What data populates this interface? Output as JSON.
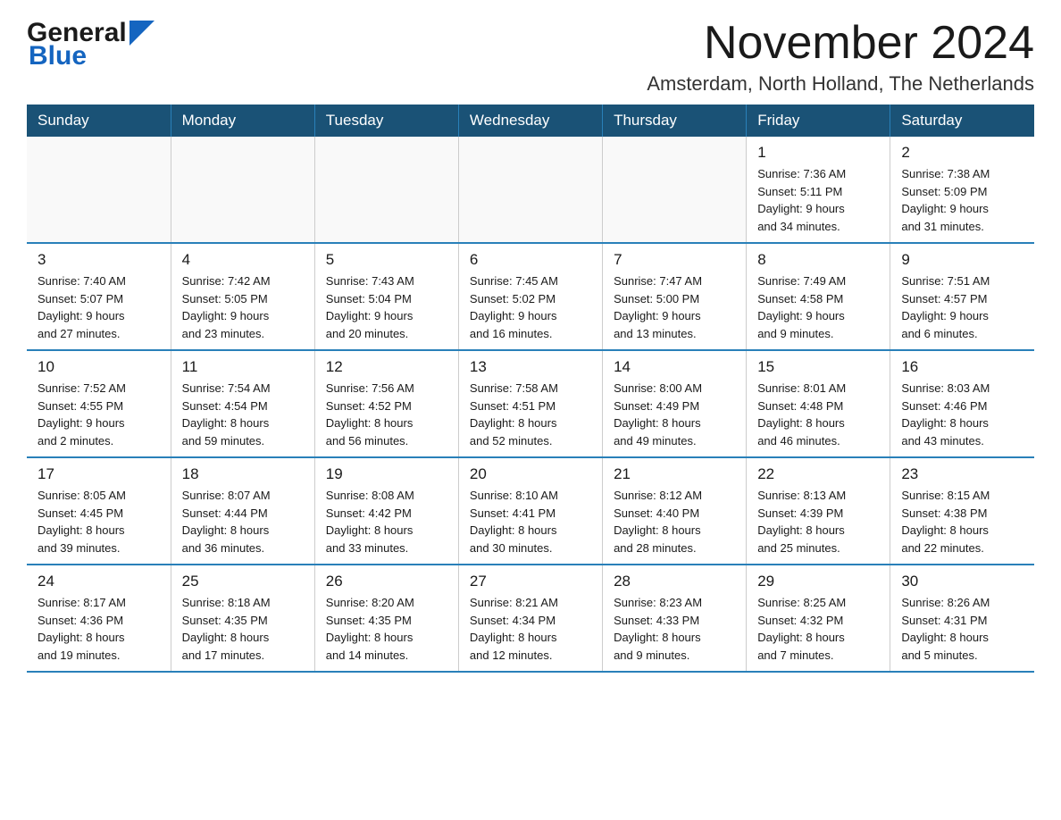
{
  "header": {
    "logo_general": "General",
    "logo_blue": "Blue",
    "month_title": "November 2024",
    "location": "Amsterdam, North Holland, The Netherlands"
  },
  "calendar": {
    "weekdays": [
      "Sunday",
      "Monday",
      "Tuesday",
      "Wednesday",
      "Thursday",
      "Friday",
      "Saturday"
    ],
    "weeks": [
      [
        {
          "day": "",
          "info": ""
        },
        {
          "day": "",
          "info": ""
        },
        {
          "day": "",
          "info": ""
        },
        {
          "day": "",
          "info": ""
        },
        {
          "day": "",
          "info": ""
        },
        {
          "day": "1",
          "info": "Sunrise: 7:36 AM\nSunset: 5:11 PM\nDaylight: 9 hours\nand 34 minutes."
        },
        {
          "day": "2",
          "info": "Sunrise: 7:38 AM\nSunset: 5:09 PM\nDaylight: 9 hours\nand 31 minutes."
        }
      ],
      [
        {
          "day": "3",
          "info": "Sunrise: 7:40 AM\nSunset: 5:07 PM\nDaylight: 9 hours\nand 27 minutes."
        },
        {
          "day": "4",
          "info": "Sunrise: 7:42 AM\nSunset: 5:05 PM\nDaylight: 9 hours\nand 23 minutes."
        },
        {
          "day": "5",
          "info": "Sunrise: 7:43 AM\nSunset: 5:04 PM\nDaylight: 9 hours\nand 20 minutes."
        },
        {
          "day": "6",
          "info": "Sunrise: 7:45 AM\nSunset: 5:02 PM\nDaylight: 9 hours\nand 16 minutes."
        },
        {
          "day": "7",
          "info": "Sunrise: 7:47 AM\nSunset: 5:00 PM\nDaylight: 9 hours\nand 13 minutes."
        },
        {
          "day": "8",
          "info": "Sunrise: 7:49 AM\nSunset: 4:58 PM\nDaylight: 9 hours\nand 9 minutes."
        },
        {
          "day": "9",
          "info": "Sunrise: 7:51 AM\nSunset: 4:57 PM\nDaylight: 9 hours\nand 6 minutes."
        }
      ],
      [
        {
          "day": "10",
          "info": "Sunrise: 7:52 AM\nSunset: 4:55 PM\nDaylight: 9 hours\nand 2 minutes."
        },
        {
          "day": "11",
          "info": "Sunrise: 7:54 AM\nSunset: 4:54 PM\nDaylight: 8 hours\nand 59 minutes."
        },
        {
          "day": "12",
          "info": "Sunrise: 7:56 AM\nSunset: 4:52 PM\nDaylight: 8 hours\nand 56 minutes."
        },
        {
          "day": "13",
          "info": "Sunrise: 7:58 AM\nSunset: 4:51 PM\nDaylight: 8 hours\nand 52 minutes."
        },
        {
          "day": "14",
          "info": "Sunrise: 8:00 AM\nSunset: 4:49 PM\nDaylight: 8 hours\nand 49 minutes."
        },
        {
          "day": "15",
          "info": "Sunrise: 8:01 AM\nSunset: 4:48 PM\nDaylight: 8 hours\nand 46 minutes."
        },
        {
          "day": "16",
          "info": "Sunrise: 8:03 AM\nSunset: 4:46 PM\nDaylight: 8 hours\nand 43 minutes."
        }
      ],
      [
        {
          "day": "17",
          "info": "Sunrise: 8:05 AM\nSunset: 4:45 PM\nDaylight: 8 hours\nand 39 minutes."
        },
        {
          "day": "18",
          "info": "Sunrise: 8:07 AM\nSunset: 4:44 PM\nDaylight: 8 hours\nand 36 minutes."
        },
        {
          "day": "19",
          "info": "Sunrise: 8:08 AM\nSunset: 4:42 PM\nDaylight: 8 hours\nand 33 minutes."
        },
        {
          "day": "20",
          "info": "Sunrise: 8:10 AM\nSunset: 4:41 PM\nDaylight: 8 hours\nand 30 minutes."
        },
        {
          "day": "21",
          "info": "Sunrise: 8:12 AM\nSunset: 4:40 PM\nDaylight: 8 hours\nand 28 minutes."
        },
        {
          "day": "22",
          "info": "Sunrise: 8:13 AM\nSunset: 4:39 PM\nDaylight: 8 hours\nand 25 minutes."
        },
        {
          "day": "23",
          "info": "Sunrise: 8:15 AM\nSunset: 4:38 PM\nDaylight: 8 hours\nand 22 minutes."
        }
      ],
      [
        {
          "day": "24",
          "info": "Sunrise: 8:17 AM\nSunset: 4:36 PM\nDaylight: 8 hours\nand 19 minutes."
        },
        {
          "day": "25",
          "info": "Sunrise: 8:18 AM\nSunset: 4:35 PM\nDaylight: 8 hours\nand 17 minutes."
        },
        {
          "day": "26",
          "info": "Sunrise: 8:20 AM\nSunset: 4:35 PM\nDaylight: 8 hours\nand 14 minutes."
        },
        {
          "day": "27",
          "info": "Sunrise: 8:21 AM\nSunset: 4:34 PM\nDaylight: 8 hours\nand 12 minutes."
        },
        {
          "day": "28",
          "info": "Sunrise: 8:23 AM\nSunset: 4:33 PM\nDaylight: 8 hours\nand 9 minutes."
        },
        {
          "day": "29",
          "info": "Sunrise: 8:25 AM\nSunset: 4:32 PM\nDaylight: 8 hours\nand 7 minutes."
        },
        {
          "day": "30",
          "info": "Sunrise: 8:26 AM\nSunset: 4:31 PM\nDaylight: 8 hours\nand 5 minutes."
        }
      ]
    ]
  }
}
